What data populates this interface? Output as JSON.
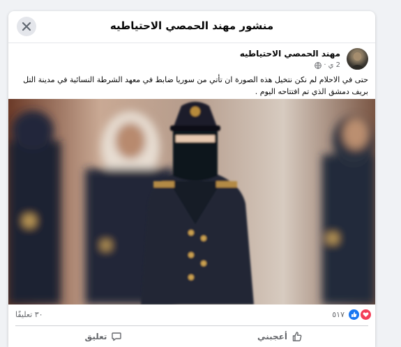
{
  "dialog": {
    "title": "منشور مهند الحمصي الاحتياطيه",
    "close_icon": "close-icon"
  },
  "post": {
    "author": "مهند الحمصي الاحتياطيه",
    "time": "2 ي",
    "privacy_icon": "globe-icon",
    "text": "حتى في الاحلام لم نكن نتخيل هذه الصورة ان تأتي من سوريا  ضابط في معهد الشرطة النسائية في مدينة التل بريف دمشق الذي تم افتتاحه اليوم ."
  },
  "photo": {
    "subject": "masked policewoman officer in dark uniform and peaked cap"
  },
  "stats": {
    "reactions_count": "٥١٧",
    "comments_count": "٣٠ تعليقًا",
    "reaction_icons": [
      "like-icon",
      "love-icon"
    ]
  },
  "actions": {
    "like_label": "أعجبني",
    "comment_label": "تعليق"
  },
  "colors": {
    "like_blue": "#1877f2",
    "love_red": "#f33e58",
    "secondary_text": "#65676b"
  }
}
